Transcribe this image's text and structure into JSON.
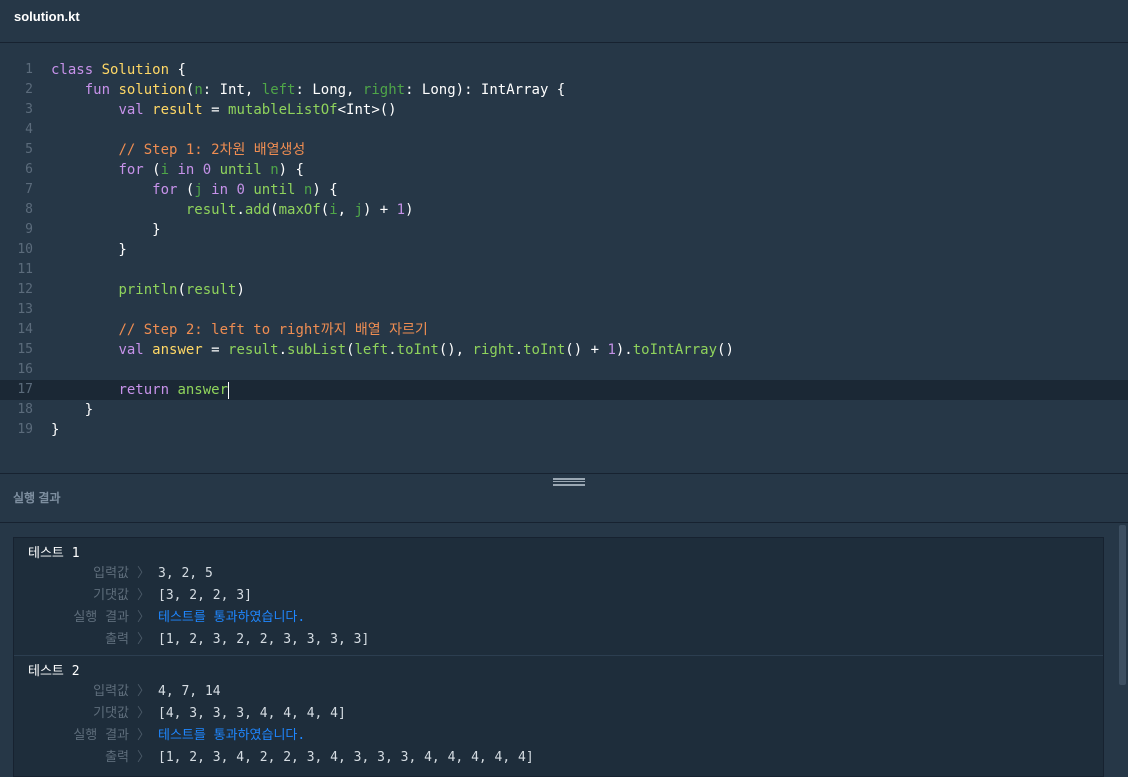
{
  "file": {
    "name": "solution.kt"
  },
  "colors": {
    "keyword": "#c792ea",
    "function": "#8fd35c",
    "param": "#4fa648",
    "identifier": "#ffd866",
    "number": "#c391e6",
    "comment": "#ef8d52",
    "type": "#ffffff",
    "plain": "#ffffff"
  },
  "editor": {
    "active_line": 17,
    "lines": [
      {
        "n": "1",
        "tokens": [
          [
            "class ",
            "keyword"
          ],
          [
            "Solution",
            "identifier"
          ],
          [
            " {",
            "plain"
          ]
        ]
      },
      {
        "n": "2",
        "tokens": [
          [
            "    ",
            "plain"
          ],
          [
            "fun ",
            "keyword"
          ],
          [
            "solution",
            "identifier"
          ],
          [
            "(",
            "plain"
          ],
          [
            "n",
            "param"
          ],
          [
            ": Int, ",
            "plain"
          ],
          [
            "left",
            "param"
          ],
          [
            ": Long, ",
            "plain"
          ],
          [
            "right",
            "param"
          ],
          [
            ": Long): IntArray {",
            "plain"
          ]
        ]
      },
      {
        "n": "3",
        "tokens": [
          [
            "        ",
            "plain"
          ],
          [
            "val ",
            "keyword"
          ],
          [
            "result",
            "identifier"
          ],
          [
            " = ",
            "plain"
          ],
          [
            "mutableListOf",
            "function"
          ],
          [
            "<Int>()",
            "plain"
          ]
        ]
      },
      {
        "n": "4",
        "tokens": []
      },
      {
        "n": "5",
        "tokens": [
          [
            "        ",
            "plain"
          ],
          [
            "// Step 1: 2차원 배열생성",
            "comment"
          ]
        ]
      },
      {
        "n": "6",
        "tokens": [
          [
            "        ",
            "plain"
          ],
          [
            "for ",
            "keyword"
          ],
          [
            "(",
            "plain"
          ],
          [
            "i ",
            "param"
          ],
          [
            "in ",
            "keyword"
          ],
          [
            "0 ",
            "number"
          ],
          [
            "until ",
            "function"
          ],
          [
            "n",
            "param"
          ],
          [
            ") {",
            "plain"
          ]
        ]
      },
      {
        "n": "7",
        "tokens": [
          [
            "            ",
            "plain"
          ],
          [
            "for ",
            "keyword"
          ],
          [
            "(",
            "plain"
          ],
          [
            "j ",
            "param"
          ],
          [
            "in ",
            "keyword"
          ],
          [
            "0 ",
            "number"
          ],
          [
            "until ",
            "function"
          ],
          [
            "n",
            "param"
          ],
          [
            ") {",
            "plain"
          ]
        ]
      },
      {
        "n": "8",
        "tokens": [
          [
            "                ",
            "plain"
          ],
          [
            "result",
            "function"
          ],
          [
            ".",
            "plain"
          ],
          [
            "add",
            "function"
          ],
          [
            "(",
            "plain"
          ],
          [
            "maxOf",
            "function"
          ],
          [
            "(",
            "plain"
          ],
          [
            "i",
            "param"
          ],
          [
            ", ",
            "plain"
          ],
          [
            "j",
            "param"
          ],
          [
            ") + ",
            "plain"
          ],
          [
            "1",
            "number"
          ],
          [
            ")",
            "plain"
          ]
        ]
      },
      {
        "n": "9",
        "tokens": [
          [
            "            }",
            "plain"
          ]
        ]
      },
      {
        "n": "10",
        "tokens": [
          [
            "        }",
            "plain"
          ]
        ]
      },
      {
        "n": "11",
        "tokens": []
      },
      {
        "n": "12",
        "tokens": [
          [
            "        ",
            "plain"
          ],
          [
            "println",
            "function"
          ],
          [
            "(",
            "plain"
          ],
          [
            "result",
            "function"
          ],
          [
            ")",
            "plain"
          ]
        ]
      },
      {
        "n": "13",
        "tokens": []
      },
      {
        "n": "14",
        "tokens": [
          [
            "        ",
            "plain"
          ],
          [
            "// Step 2: left to right까지 배열 자르기",
            "comment"
          ]
        ]
      },
      {
        "n": "15",
        "tokens": [
          [
            "        ",
            "plain"
          ],
          [
            "val ",
            "keyword"
          ],
          [
            "answer",
            "identifier"
          ],
          [
            " = ",
            "plain"
          ],
          [
            "result",
            "function"
          ],
          [
            ".",
            "plain"
          ],
          [
            "subList",
            "function"
          ],
          [
            "(",
            "plain"
          ],
          [
            "left",
            "function"
          ],
          [
            ".",
            "plain"
          ],
          [
            "toInt",
            "function"
          ],
          [
            "(), ",
            "plain"
          ],
          [
            "right",
            "function"
          ],
          [
            ".",
            "plain"
          ],
          [
            "toInt",
            "function"
          ],
          [
            "() + ",
            "plain"
          ],
          [
            "1",
            "number"
          ],
          [
            ").",
            "plain"
          ],
          [
            "toIntArray",
            "function"
          ],
          [
            "()",
            "plain"
          ]
        ]
      },
      {
        "n": "16",
        "tokens": []
      },
      {
        "n": "17",
        "tokens": [
          [
            "        ",
            "plain"
          ],
          [
            "return ",
            "keyword"
          ],
          [
            "answer",
            "function"
          ]
        ]
      },
      {
        "n": "18",
        "tokens": [
          [
            "    }",
            "plain"
          ]
        ]
      },
      {
        "n": "19",
        "tokens": [
          [
            "}",
            "plain"
          ]
        ]
      }
    ]
  },
  "results_panel": {
    "title": "실행 결과",
    "separator": "〉",
    "tests": [
      {
        "name": "테스트 1",
        "rows": [
          {
            "label": "입력값",
            "value": "3, 2, 5",
            "status": "normal"
          },
          {
            "label": "기댓값",
            "value": "[3, 2, 2, 3]",
            "status": "normal"
          },
          {
            "label": "실행 결과",
            "value": "테스트를 통과하였습니다.",
            "status": "pass"
          },
          {
            "label": "출력",
            "value": "[1, 2, 3, 2, 2, 3, 3, 3, 3]",
            "status": "normal"
          }
        ]
      },
      {
        "name": "테스트 2",
        "rows": [
          {
            "label": "입력값",
            "value": "4, 7, 14",
            "status": "normal"
          },
          {
            "label": "기댓값",
            "value": "[4, 3, 3, 3, 4, 4, 4, 4]",
            "status": "normal"
          },
          {
            "label": "실행 결과",
            "value": "테스트를 통과하였습니다.",
            "status": "pass"
          },
          {
            "label": "출력",
            "value": "[1, 2, 3, 4, 2, 2, 3, 4, 3, 3, 3, 4, 4, 4, 4, 4]",
            "status": "normal"
          }
        ]
      }
    ]
  }
}
